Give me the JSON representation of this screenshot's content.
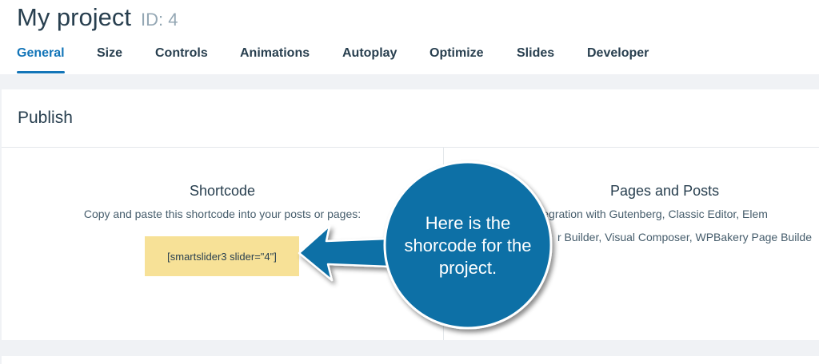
{
  "header": {
    "title": "My project",
    "project_id": "ID: 4"
  },
  "tabs": [
    {
      "label": "General",
      "active": true
    },
    {
      "label": "Size"
    },
    {
      "label": "Controls"
    },
    {
      "label": "Animations"
    },
    {
      "label": "Autoplay"
    },
    {
      "label": "Optimize"
    },
    {
      "label": "Slides"
    },
    {
      "label": "Developer"
    }
  ],
  "publish": {
    "title": "Publish",
    "shortcode": {
      "heading": "Shortcode",
      "description": "Copy and paste this shortcode into your posts or pages:",
      "value": "[smartslider3 slider=\"4\"]"
    },
    "pages_and_posts": {
      "heading": "Pages and Posts",
      "line1": "has integration with Gutenberg, Classic Editor, Elem",
      "line2": "r Builder, Visual Composer, WPBakery Page Builde"
    }
  },
  "annotation": {
    "line1": "Here is the",
    "line2": "shorcode for the",
    "line3": "project.",
    "color": "#0a6fa6"
  },
  "colors": {
    "accent": "#1375b8",
    "shortcode_bg": "#f7e197",
    "page_bg": "#f0f2f5"
  }
}
